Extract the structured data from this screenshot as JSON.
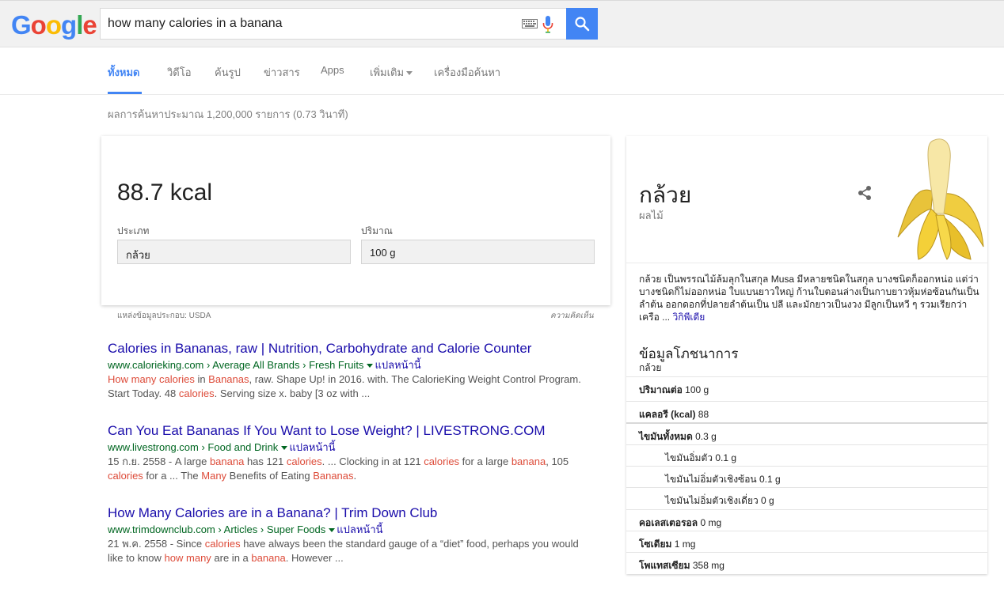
{
  "search": {
    "query": "how many calories in a banana"
  },
  "logo": {
    "letters": [
      "G",
      "o",
      "o",
      "g",
      "l",
      "e"
    ],
    "colors": [
      "#4285f4",
      "#ea4335",
      "#fbbc05",
      "#4285f4",
      "#34a853",
      "#ea4335"
    ]
  },
  "colors": {
    "accent": "#4285f4",
    "link": "#1a0dab",
    "url": "#006621",
    "highlight": "#dd4b39"
  },
  "tabs": {
    "all": "ทั้งหมด",
    "videos": "วิดีโอ",
    "images": "ค้นรูป",
    "news": "ข่าวสาร",
    "apps": "Apps",
    "more": "เพิ่มเติม",
    "tools": "เครื่องมือค้นหา"
  },
  "result_stats": "ผลการค้นหาประมาณ 1,200,000 รายการ (0.73 วินาที)",
  "calculator": {
    "value": "88.7 kcal",
    "type_label": "ประเภท",
    "type_value": "กล้วย",
    "amount_label": "ปริมาณ",
    "amount_value": "100 g",
    "source": "แหล่งข้อมูลประกอบ: USDA",
    "feedback": "ความคิดเห็น"
  },
  "results": [
    {
      "title": "Calories in Bananas, raw | Nutrition, Carbohydrate and Calorie Counter",
      "url": "www.calorieking.com › Average All Brands › Fresh Fruits",
      "translate": "แปลหน้านี้",
      "snippet": [
        {
          "t": "How many calories",
          "h": true
        },
        {
          "t": " in ",
          "h": false
        },
        {
          "t": "Bananas",
          "h": true
        },
        {
          "t": ", raw. Shape Up! in 2016. with. The CalorieKing Weight Control Program. Start Today. 48 ",
          "h": false
        },
        {
          "t": "calories",
          "h": true
        },
        {
          "t": ". Serving size x. baby [3 oz with ...",
          "h": false
        }
      ]
    },
    {
      "title": "Can You Eat Bananas If You Want to Lose Weight? | LIVESTRONG.COM",
      "url": "www.livestrong.com › Food and Drink",
      "translate": "แปลหน้านี้",
      "snippet": [
        {
          "t": "15 ก.ย. 2558 - A large ",
          "h": false
        },
        {
          "t": "banana",
          "h": true
        },
        {
          "t": " has 121 ",
          "h": false
        },
        {
          "t": "calories",
          "h": true
        },
        {
          "t": ". ... Clocking in at 121 ",
          "h": false
        },
        {
          "t": "calories",
          "h": true
        },
        {
          "t": " for a large ",
          "h": false
        },
        {
          "t": "banana",
          "h": true
        },
        {
          "t": ", 105 ",
          "h": false
        },
        {
          "t": "calories",
          "h": true
        },
        {
          "t": " for a ... The ",
          "h": false
        },
        {
          "t": "Many",
          "h": true
        },
        {
          "t": " Benefits of Eating ",
          "h": false
        },
        {
          "t": "Bananas",
          "h": true
        },
        {
          "t": ".",
          "h": false
        }
      ]
    },
    {
      "title": "How Many Calories are in a Banana? | Trim Down Club",
      "url": "www.trimdownclub.com › Articles › Super Foods",
      "translate": "แปลหน้านี้",
      "snippet": [
        {
          "t": "21 พ.ค. 2558 - Since ",
          "h": false
        },
        {
          "t": "calories",
          "h": true
        },
        {
          "t": " have always been the standard gauge of a “diet” food, perhaps you would like to know ",
          "h": false
        },
        {
          "t": "how many",
          "h": true
        },
        {
          "t": " are in a ",
          "h": false
        },
        {
          "t": "banana",
          "h": true
        },
        {
          "t": ". However ...",
          "h": false
        }
      ]
    }
  ],
  "knowledge_panel": {
    "title": "กล้วย",
    "subtitle": "ผลไม้",
    "description": "กล้วย เป็นพรรณไม้ล้มลุกในสกุล Musa มีหลายชนิดในสกุล บางชนิดก็ออกหน่อ แต่ว่าบางชนิดก็ไม่ออกหน่อ ใบแบนยาวใหญ่ ก้านใบตอนล่างเป็นกาบยาวหุ้มห่อซ้อนกันเป็นลำต้น ออกดอกที่ปลายลำต้นเป็น ปลี และมักยาวเป็นงวง มีลูกเป็นหวี ๆ รวมเรียกว่า เครือ ...",
    "wiki_link": "วิกิพีเดีย",
    "nutrition_title": "ข้อมูลโภชนาการ",
    "nutrition_subtitle": "กล้วย",
    "nutrition": [
      {
        "label": "ปริมาณต่อ",
        "value": "100 g",
        "indent": false
      },
      {
        "label": "แคลอรี (kcal)",
        "value": "88",
        "indent": false
      },
      {
        "label": "ไขมันทั้งหมด",
        "value": "0.3 g",
        "indent": false
      },
      {
        "label": "ไขมันอิ่มตัว",
        "value": "0.1 g",
        "indent": true
      },
      {
        "label": "ไขมันไม่อิ่มตัวเชิงซ้อน",
        "value": "0.1 g",
        "indent": true
      },
      {
        "label": "ไขมันไม่อิ่มตัวเชิงเดี่ยว",
        "value": "0 g",
        "indent": true
      },
      {
        "label": "คอเลสเตอรอล",
        "value": "0 mg",
        "indent": false
      },
      {
        "label": "โซเดียม",
        "value": "1 mg",
        "indent": false
      },
      {
        "label": "โพแทสเซียม",
        "value": "358 mg",
        "indent": false
      }
    ]
  }
}
